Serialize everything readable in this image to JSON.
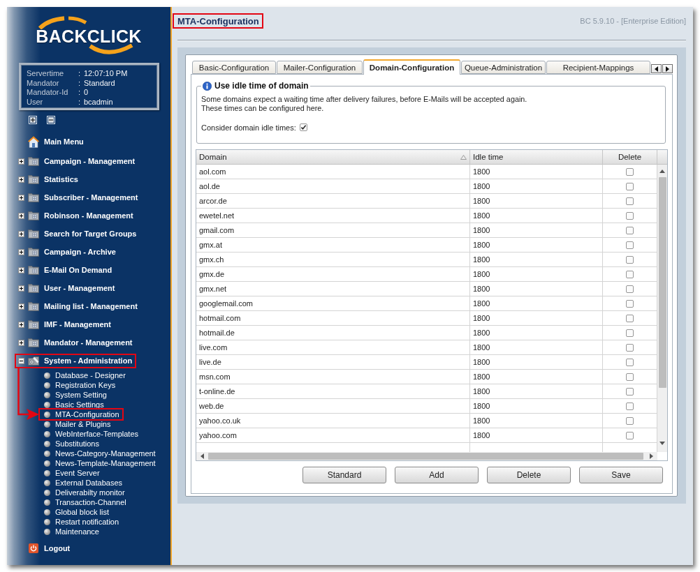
{
  "sidebar": {
    "logo": "BACKCLICK",
    "info": [
      {
        "label": "Servertime",
        "separator": ":",
        "value": "12:07:10 PM"
      },
      {
        "label": "Mandator",
        "separator": ":",
        "value": "Standard"
      },
      {
        "label": "Mandator-Id",
        "separator": ":",
        "value": "0"
      },
      {
        "label": "User",
        "separator": ":",
        "value": "bcadmin"
      }
    ],
    "main_menu": "Main Menu",
    "menu": [
      {
        "label": "Campaign - Management",
        "kind": "folder",
        "expanded": false,
        "highlighted": false
      },
      {
        "label": "Statistics",
        "kind": "folder",
        "expanded": false,
        "highlighted": false
      },
      {
        "label": "Subscriber - Management",
        "kind": "folder",
        "expanded": false,
        "highlighted": false
      },
      {
        "label": "Robinson - Management",
        "kind": "folder",
        "expanded": false,
        "highlighted": false
      },
      {
        "label": "Search for Target Groups",
        "kind": "folder",
        "expanded": false,
        "highlighted": false
      },
      {
        "label": "Campaign - Archive",
        "kind": "folder",
        "expanded": false,
        "highlighted": false
      },
      {
        "label": "E-Mail On Demand",
        "kind": "folder",
        "expanded": false,
        "highlighted": false
      },
      {
        "label": "User - Management",
        "kind": "folder",
        "expanded": false,
        "highlighted": false
      },
      {
        "label": "Mailing list - Management",
        "kind": "folder",
        "expanded": false,
        "highlighted": false
      },
      {
        "label": "IMF - Management",
        "kind": "folder",
        "expanded": false,
        "highlighted": false
      },
      {
        "label": "Mandator - Management",
        "kind": "folder",
        "expanded": false,
        "highlighted": false
      },
      {
        "label": "System - Administration",
        "kind": "tools",
        "expanded": true,
        "highlighted": true,
        "children": [
          {
            "label": "Database - Designer",
            "highlighted": false
          },
          {
            "label": "Registration Keys",
            "highlighted": false
          },
          {
            "label": "System Setting",
            "highlighted": false
          },
          {
            "label": "Basic Settings",
            "highlighted": false
          },
          {
            "label": "MTA-Configuration",
            "highlighted": true
          },
          {
            "label": "Mailer & Plugins",
            "highlighted": false
          },
          {
            "label": "WebInterface-Templates",
            "highlighted": false
          },
          {
            "label": "Substitutions",
            "highlighted": false
          },
          {
            "label": "News-Category-Management",
            "highlighted": false
          },
          {
            "label": "News-Template-Management",
            "highlighted": false
          },
          {
            "label": "Event Server",
            "highlighted": false
          },
          {
            "label": "External Databases",
            "highlighted": false
          },
          {
            "label": "Deliverabilty monitor",
            "highlighted": false
          },
          {
            "label": "Transaction-Channel",
            "highlighted": false
          },
          {
            "label": "Global block list",
            "highlighted": false
          },
          {
            "label": "Restart notification",
            "highlighted": false
          },
          {
            "label": "Maintenance",
            "highlighted": false
          }
        ]
      }
    ],
    "callout_arrow": true,
    "logout": "Logout"
  },
  "header": {
    "title": "MTA-Configuration",
    "highlighted": true,
    "version": "BC 5.9.10 - [Enterprise Edition]"
  },
  "tabs": [
    {
      "label": "Basic-Configuration",
      "selected": false
    },
    {
      "label": "Mailer-Configuration",
      "selected": false
    },
    {
      "label": "Domain-Configuration",
      "selected": true
    },
    {
      "label": "Queue-Administration",
      "selected": false
    },
    {
      "label": "Recipient-Mappings",
      "selected": false
    }
  ],
  "fieldset": {
    "legend": "Use idle time of domain",
    "description": [
      "Some domains expect a waiting time after delivery failures, before E-Mails will be accepted again.",
      "These times can be configured here."
    ],
    "checkbox": {
      "label": "Consider domain idle times:",
      "checked": true
    }
  },
  "table": {
    "columns": [
      {
        "label": "Domain",
        "sorted": true
      },
      {
        "label": "Idle time",
        "sorted": false
      },
      {
        "label": "Delete",
        "sorted": false
      }
    ],
    "rows": [
      {
        "domain": "aol.com",
        "idle_time": "1800",
        "delete": false
      },
      {
        "domain": "aol.de",
        "idle_time": "1800",
        "delete": false
      },
      {
        "domain": "arcor.de",
        "idle_time": "1800",
        "delete": false
      },
      {
        "domain": "ewetel.net",
        "idle_time": "1800",
        "delete": false
      },
      {
        "domain": "gmail.com",
        "idle_time": "1800",
        "delete": false
      },
      {
        "domain": "gmx.at",
        "idle_time": "1800",
        "delete": false
      },
      {
        "domain": "gmx.ch",
        "idle_time": "1800",
        "delete": false
      },
      {
        "domain": "gmx.de",
        "idle_time": "1800",
        "delete": false
      },
      {
        "domain": "gmx.net",
        "idle_time": "1800",
        "delete": false
      },
      {
        "domain": "googlemail.com",
        "idle_time": "1800",
        "delete": false
      },
      {
        "domain": "hotmail.com",
        "idle_time": "1800",
        "delete": false
      },
      {
        "domain": "hotmail.de",
        "idle_time": "1800",
        "delete": false
      },
      {
        "domain": "live.com",
        "idle_time": "1800",
        "delete": false
      },
      {
        "domain": "live.de",
        "idle_time": "1800",
        "delete": false
      },
      {
        "domain": "msn.com",
        "idle_time": "1800",
        "delete": false
      },
      {
        "domain": "t-online.de",
        "idle_time": "1800",
        "delete": false
      },
      {
        "domain": "web.de",
        "idle_time": "1800",
        "delete": false
      },
      {
        "domain": "yahoo.co.uk",
        "idle_time": "1800",
        "delete": false
      },
      {
        "domain": "yahoo.com",
        "idle_time": "1800",
        "delete": false
      }
    ]
  },
  "buttons": [
    "Standard",
    "Add",
    "Delete",
    "Save"
  ]
}
